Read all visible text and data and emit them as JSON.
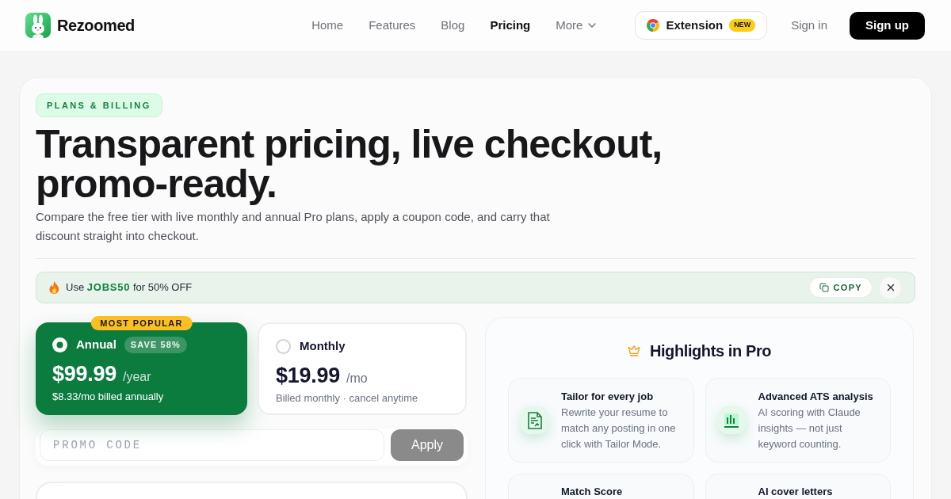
{
  "nav": {
    "brand": "Rezoomed",
    "links": [
      {
        "label": "Home",
        "selected": false,
        "kind": "link"
      },
      {
        "label": "Features",
        "selected": false,
        "kind": "link"
      },
      {
        "label": "Blog",
        "selected": false,
        "kind": "link"
      },
      {
        "label": "Pricing",
        "selected": true,
        "kind": "link"
      },
      {
        "label": "More",
        "selected": false,
        "kind": "dropdown"
      }
    ],
    "extension": {
      "label": "Extension",
      "badge": "NEW"
    },
    "sign_in": "Sign in",
    "sign_up": "Sign up"
  },
  "hero": {
    "eyebrow": "PLANS & BILLING",
    "title": "Transparent pricing, live checkout, promo-ready.",
    "subtitle": "Compare the free tier with live monthly and annual Pro plans, apply a coupon code, and carry that discount straight into checkout."
  },
  "promo_banner": {
    "text": "Use **JOBS50** for 50% OFF",
    "copy_button": "COPY"
  },
  "plans": [
    {
      "name": "Annual",
      "selected": true,
      "ribbon": "MOST POPULAR",
      "badge": "SAVE 58%",
      "price": "$99.99",
      "period": "/year",
      "note": "$8.33/mo billed annually"
    },
    {
      "name": "Monthly",
      "selected": false,
      "price": "$19.99",
      "period": "/mo",
      "note": "Billed monthly · cancel anytime"
    }
  ],
  "promo_form": {
    "placeholder": "PROMO CODE",
    "button": "Apply",
    "disabled": true
  },
  "highlights": {
    "title": "Highlights in Pro",
    "features": [
      {
        "title": "Tailor for every job",
        "description": "Rewrite your resume to match any posting in one click with Tailor Mode."
      },
      {
        "title": "Advanced ATS analysis",
        "description": "AI scoring with Claude insights — not just keyword counting."
      },
      {
        "title": "Match Score"
      },
      {
        "title": "AI cover letters"
      }
    ]
  }
}
